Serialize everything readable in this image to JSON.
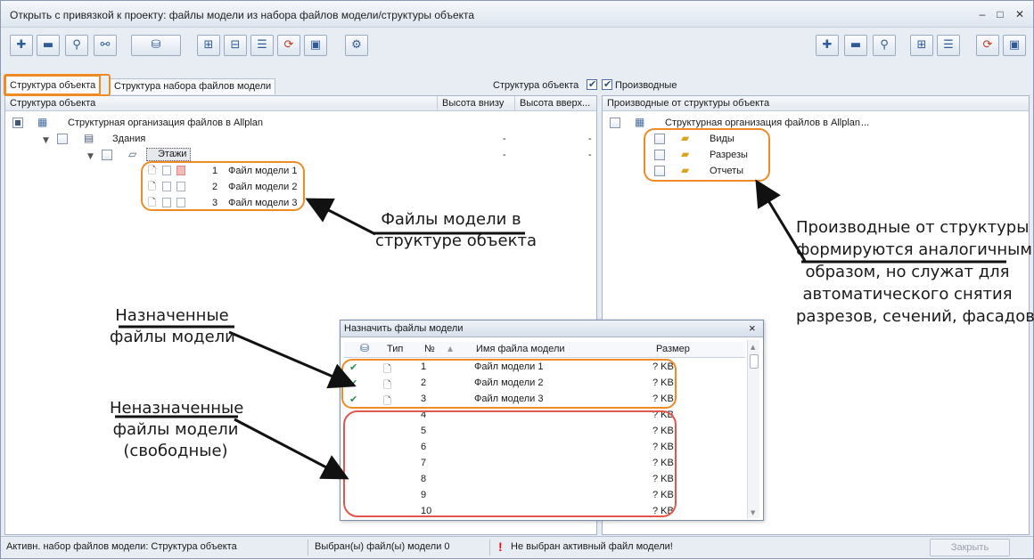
{
  "window": {
    "title": "Открыть с привязкой к проекту: файлы модели из набора файлов модели/структуры объекта",
    "controls": [
      "–",
      "□",
      "✕"
    ]
  },
  "tabs": [
    {
      "label": "Структура объекта",
      "active": true
    },
    {
      "label": "Структура набора файлов модели",
      "active": false
    }
  ],
  "filters": [
    {
      "label": "Структура объекта",
      "checked": true
    },
    {
      "label": "Производные",
      "checked": true
    }
  ],
  "left_panel": {
    "columns": [
      "Структура объекта",
      "Высота внизу",
      "Высота вверх..."
    ],
    "root": {
      "label": "Структурная организация файлов в Allplan"
    },
    "building": {
      "label": "Здания",
      "low": "-",
      "high": "-"
    },
    "floor": {
      "label": "Этажи",
      "low": "-",
      "high": "-"
    },
    "files": [
      {
        "num": "1",
        "name": "Файл модели 1"
      },
      {
        "num": "2",
        "name": "Файл модели 2"
      },
      {
        "num": "3",
        "name": "Файл модели 3"
      }
    ]
  },
  "right_panel": {
    "column": "Производные от структуры объекта",
    "root": {
      "label": "Структурная организация файлов в Allplan",
      "suffix": "..."
    },
    "items": [
      {
        "label": "Виды",
        "icon": "folder-house-icon"
      },
      {
        "label": "Разрезы",
        "icon": "folder-section-icon"
      },
      {
        "label": "Отчеты",
        "icon": "folder-report-icon"
      }
    ]
  },
  "dialog": {
    "title": "Назначить файлы модели",
    "close": "×",
    "columns": [
      "Тип",
      "№",
      "Имя файла модели",
      "Размер"
    ],
    "rows": [
      {
        "assigned": true,
        "num": "1",
        "name": "Файл модели 1",
        "size": "? KB"
      },
      {
        "assigned": true,
        "num": "2",
        "name": "Файл модели 2",
        "size": "? KB"
      },
      {
        "assigned": true,
        "num": "3",
        "name": "Файл модели 3",
        "size": "? KB"
      },
      {
        "assigned": false,
        "num": "4",
        "name": "",
        "size": "? KB"
      },
      {
        "assigned": false,
        "num": "5",
        "name": "",
        "size": "? KB"
      },
      {
        "assigned": false,
        "num": "6",
        "name": "",
        "size": "? KB"
      },
      {
        "assigned": false,
        "num": "7",
        "name": "",
        "size": "? KB"
      },
      {
        "assigned": false,
        "num": "8",
        "name": "",
        "size": "? KB"
      },
      {
        "assigned": false,
        "num": "9",
        "name": "",
        "size": "? KB"
      },
      {
        "assigned": false,
        "num": "10",
        "name": "",
        "size": "? KB"
      }
    ]
  },
  "annotations": {
    "files_in_structure": [
      "Файлы модели в",
      "структуре объекта"
    ],
    "derived": [
      "Производные от структуры",
      "формируются аналогичным",
      "образом, но служат для",
      "автоматического снятия",
      "разрезов, сечений, фасадов"
    ],
    "assigned": [
      "Назначенные",
      "файлы модели"
    ],
    "unassigned": [
      "Неназначенные",
      "файлы модели",
      "(свободные)"
    ]
  },
  "status": {
    "active_set": "Активн. набор файлов модели: Структура объекта",
    "selected": "Выбран(ы) файл(ы) модели 0",
    "warning_icon": "!",
    "warning": "Не выбран активный файл модели!",
    "close_button": "Закрыть"
  },
  "colors": {
    "highlight": "#f08a24",
    "highlight_red": "#e2574c",
    "check_green": "#2e8b57",
    "warning_red": "#e01010"
  }
}
